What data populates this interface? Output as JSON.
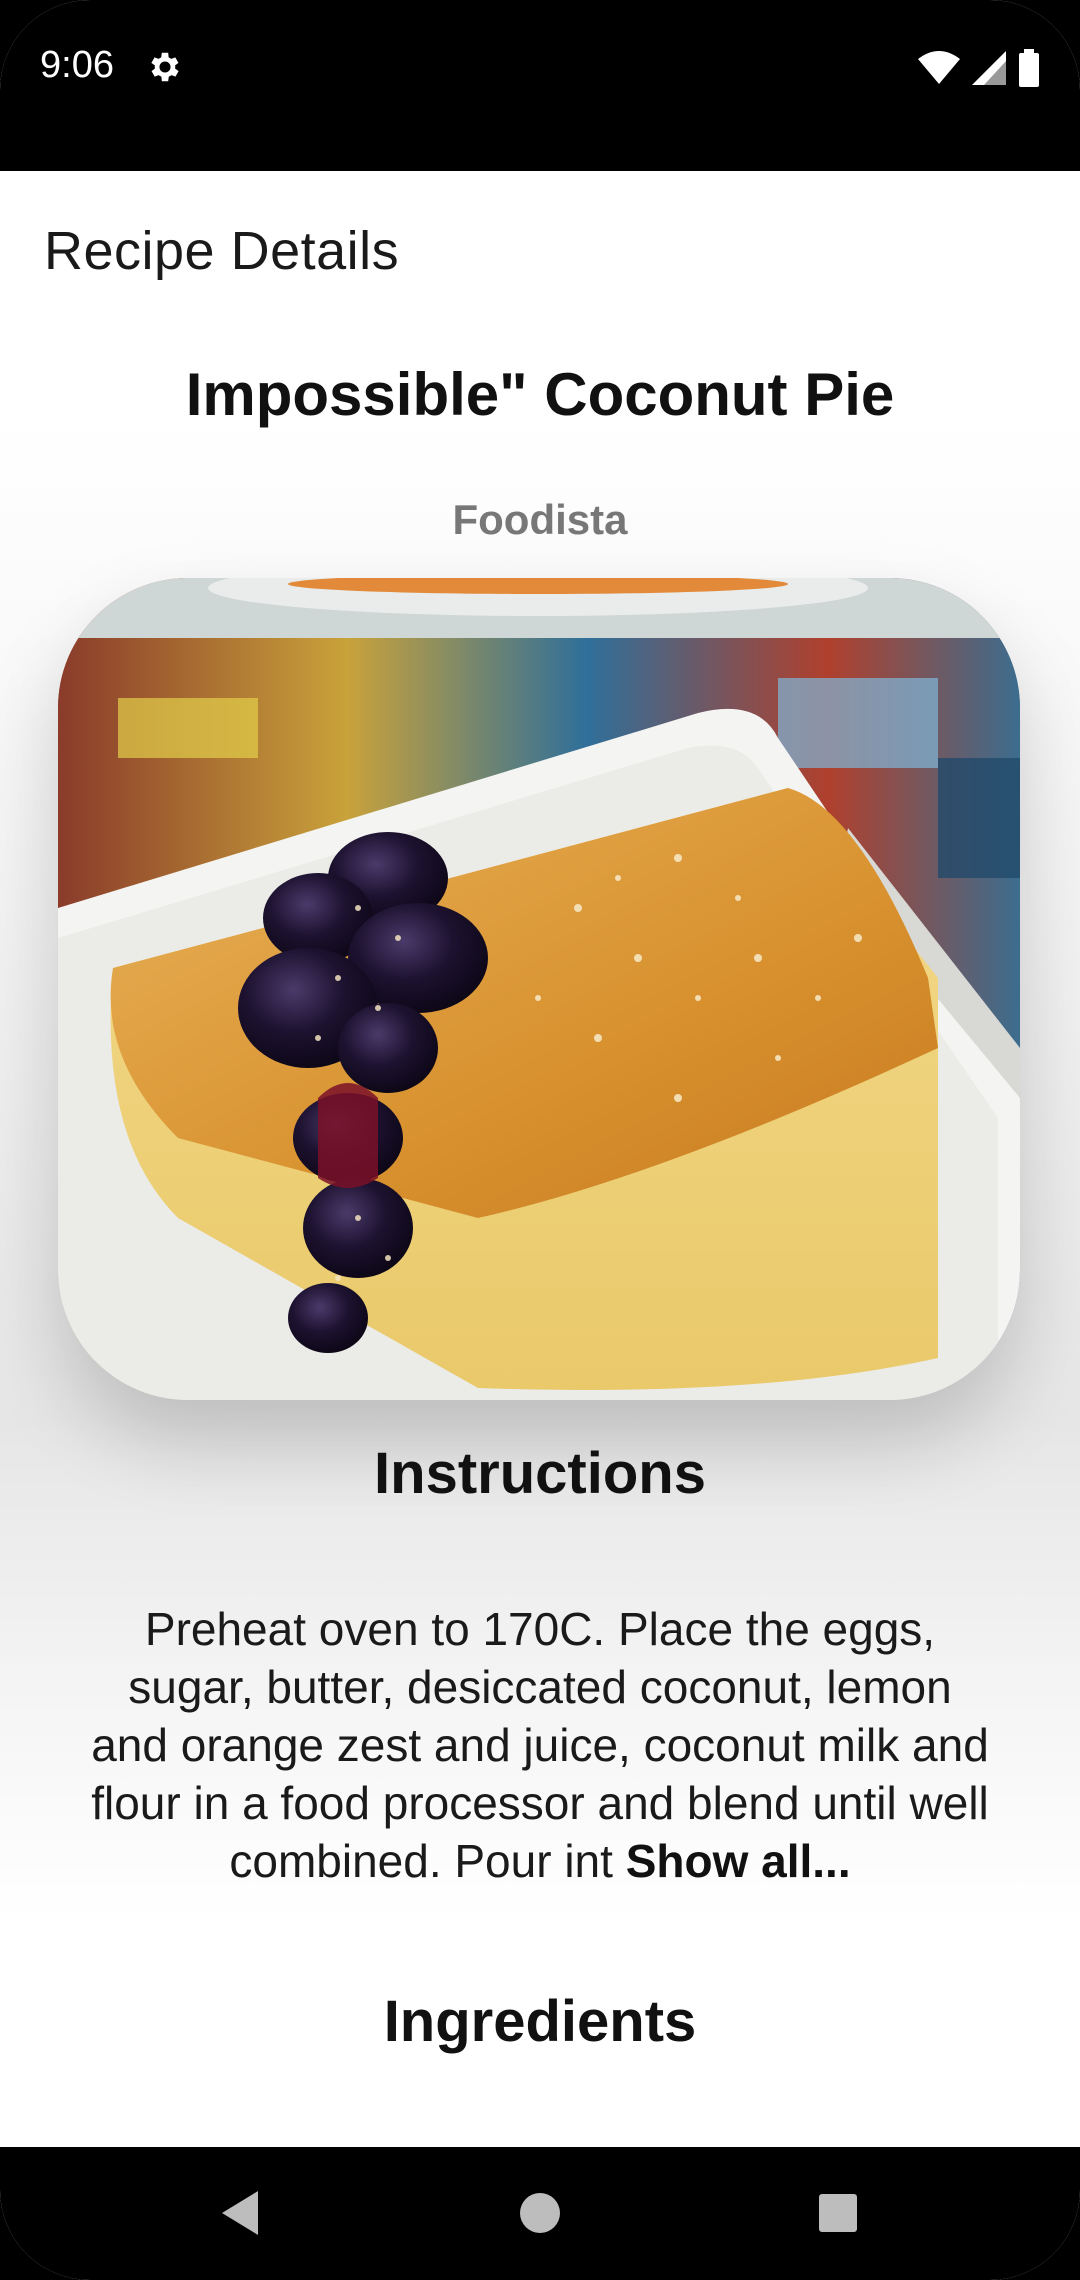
{
  "status_bar": {
    "time": "9:06",
    "icons": [
      "gear-icon",
      "wifi-icon",
      "signal-icon",
      "battery-icon"
    ]
  },
  "app_bar": {
    "title": "Recipe Details"
  },
  "recipe": {
    "title": "Impossible\" Coconut Pie",
    "source": "Foodista",
    "image_alt": "Slice of coconut pie with blueberry topping",
    "instructions_heading": "Instructions",
    "instructions_text": "Preheat oven to 170C. Place the eggs, sugar, butter, desiccated coconut, lemon and orange zest and juice, coconut milk and flour in a food processor and blend until well combined. Pour int ",
    "show_all_label": "Show all...",
    "ingredients_heading": "Ingredients"
  },
  "nav_bar": {
    "icons": [
      "back-icon",
      "home-icon",
      "recents-icon"
    ]
  },
  "colors": {
    "status_bar_bg": "#000000",
    "source_text": "#777777",
    "body_text": "#1a1a1a"
  }
}
